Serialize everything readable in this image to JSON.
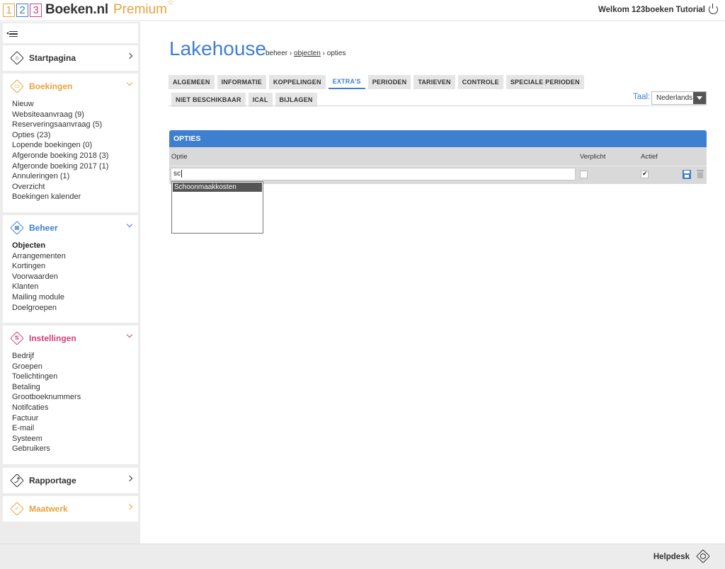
{
  "header": {
    "logo_digits": [
      "1",
      "2",
      "3"
    ],
    "brand": "Boeken.nl",
    "premium": "Premium",
    "star": "☆",
    "welcome": "Welkom 123boeken Tutorial"
  },
  "sidebar": {
    "startpagina": {
      "title": "Startpagina"
    },
    "boekingen": {
      "title": "Boekingen",
      "items": [
        "Nieuw",
        "Websiteaanvraag (9)",
        "Reserveringsaanvraag (5)",
        "Opties (23)",
        "Lopende boekingen (0)",
        "Afgeronde boeking 2018 (3)",
        "Afgeronde boeking 2017 (1)",
        "Annuleringen (1)",
        "Overzicht",
        "Boekingen kalender"
      ]
    },
    "beheer": {
      "title": "Beheer",
      "items": [
        "Objecten",
        "Arrangementen",
        "Kortingen",
        "Voorwaarden",
        "Klanten",
        "Mailing module",
        "Doelgroepen"
      ]
    },
    "instellingen": {
      "title": "Instellingen",
      "items": [
        "Bedrijf",
        "Groepen",
        "Toelichtingen",
        "Betaling",
        "Grootboeknummers",
        "Notifcaties",
        "Factuur",
        "E-mail",
        "Systeem",
        "Gebruikers"
      ]
    },
    "rapportage": {
      "title": "Rapportage"
    },
    "maatwerk": {
      "title": "Maatwerk"
    }
  },
  "main": {
    "title": "Lakehouse",
    "breadcrumb": {
      "first": "beheer",
      "sep": "›",
      "second": "objecten",
      "third": "opties"
    },
    "tabs_row1": [
      "ALGEMEEN",
      "INFORMATIE",
      "KOPPELINGEN",
      "EXTRA'S",
      "PERIODEN",
      "TARIEVEN",
      "CONTROLE",
      "SPECIALE PERIODEN"
    ],
    "tabs_row2": [
      "NIET BESCHIKBAAR",
      "ICAL",
      "BIJLAGEN"
    ],
    "active_tab": "EXTRA'S",
    "taal_label": "Taal:",
    "taal_value": "Nederlands",
    "panel": {
      "title": "OPTIES",
      "col_optie": "Optie",
      "col_verplicht": "Verplicht",
      "col_actief": "Actief",
      "input_value": "sc",
      "verplicht_checked": false,
      "actief_checked": true,
      "autocomplete": [
        "Schoonmaakkosten"
      ]
    }
  },
  "footer": {
    "helpdesk": "Helpdesk"
  },
  "colors": {
    "blue": "#3f7fcf",
    "orange": "#e8a33d",
    "pink": "#d2417a",
    "dark": "#333333"
  }
}
